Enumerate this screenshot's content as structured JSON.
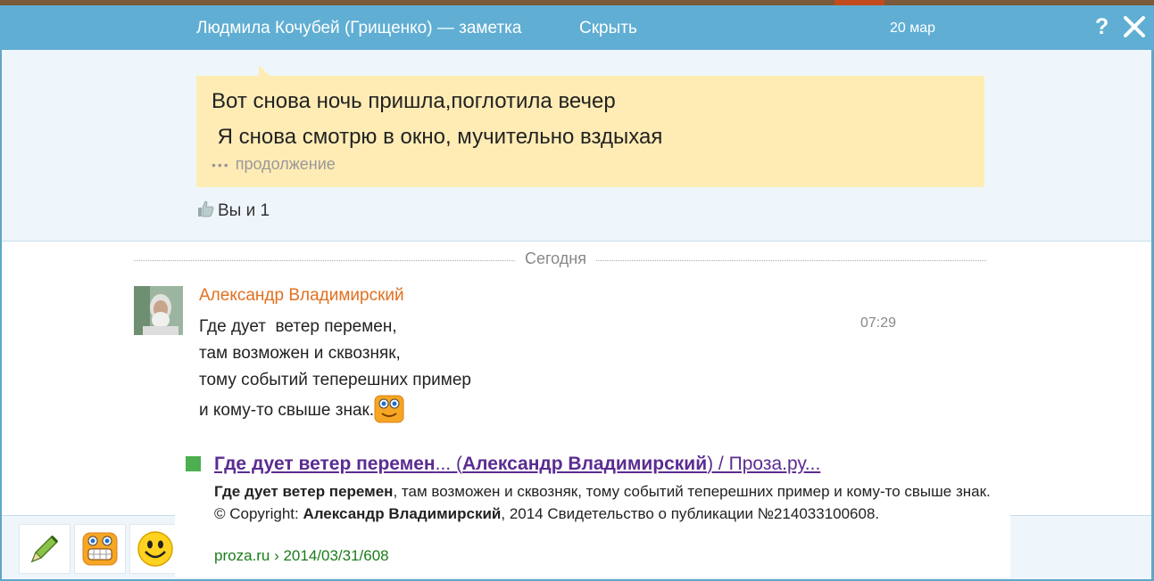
{
  "header": {
    "title": "Людмила Кочубей (Грищенко) — заметка",
    "hide_label": "Скрыть",
    "date": "20 мар",
    "help_label": "?"
  },
  "note": {
    "line1": "Вот снова ночь пришла,поглотила вечер",
    "line2": " Я снова смотрю в окно, мучительно вздыхая",
    "dots": "•••",
    "more_label": "продолжение"
  },
  "likes": {
    "text": "Вы и 1"
  },
  "divider_label": "Сегодня",
  "comment": {
    "author": "Александр Владимирский",
    "lines": [
      "Где дует  ветер перемен,",
      "там возможен и сквозняк,",
      "тому событий теперешних пример",
      "и кому-то свыше знак."
    ],
    "time": "07:29"
  },
  "preview": {
    "title_part1": "Где дует ветер перемен",
    "title_part2": "... (",
    "title_part3": "Александр Владимирский",
    "title_part4": ") / Проза.ру...",
    "desc_b1": "Где дует ветер перемен",
    "desc_t1": ", там возможен и сквозняк, тому событий теперешних пример и кому-то свыше знак. © Copyright: ",
    "desc_b2": "Александр Владимирский",
    "desc_t2": ", 2014 Свидетельство о публикации №214033100608.",
    "url": "proza.ru › 2014/03/31/608"
  },
  "icons": {
    "close": "close-icon",
    "like": "thumbs-up-icon",
    "pencil": "pencil-icon",
    "grin": "grin-smiley-icon",
    "smile": "smiley-icon"
  },
  "colors": {
    "header_bg": "#60aed3",
    "author": "#e07020",
    "note_bg": "#ffecb5",
    "link": "#5b2c91",
    "url": "#1a7d1a"
  }
}
